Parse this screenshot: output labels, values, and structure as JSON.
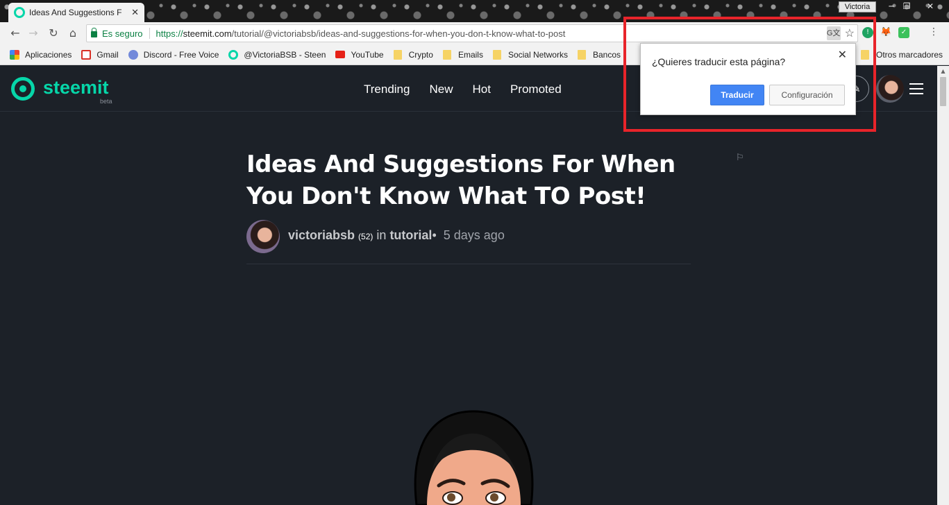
{
  "browser": {
    "tab_title": "Ideas And Suggestions For When You Don't Know What TO Post!",
    "tab_title_visible": "Ideas And Suggestions F",
    "profile_name": "Victoria",
    "secure_label": "Es seguro",
    "url_scheme": "https://",
    "url_host": "steemit.com",
    "url_path": "/tutorial/@victoriabsb/ideas-and-suggestions-for-when-you-don-t-know-what-to-post",
    "bookmarks": [
      {
        "label": "Aplicaciones",
        "icon": "apps-grid-icon",
        "color": "#4285f4"
      },
      {
        "label": "Gmail",
        "icon": "gmail-icon",
        "color": "#d93025"
      },
      {
        "label": "Discord - Free Voice",
        "icon": "discord-icon",
        "color": "#7289da"
      },
      {
        "label": "@VictoriaBSB - Steen",
        "icon": "steemit-icon",
        "color": "#06d6a9"
      },
      {
        "label": "YouTube",
        "icon": "youtube-icon",
        "color": "#e62117"
      },
      {
        "label": "Crypto",
        "icon": "folder-icon"
      },
      {
        "label": "Emails",
        "icon": "folder-icon"
      },
      {
        "label": "Social Networks",
        "icon": "folder-icon"
      },
      {
        "label": "Bancos",
        "icon": "folder-icon"
      }
    ],
    "other_bookmarks": "Otros marcadores"
  },
  "site": {
    "logo_text": "steemit",
    "logo_beta": "beta",
    "nav": [
      "Trending",
      "New",
      "Hot",
      "Promoted"
    ],
    "accent_color": "#06d6a9"
  },
  "article": {
    "title": "Ideas And Suggestions For When You Don't Know What TO Post!",
    "author": "victoriabsb",
    "reputation": "(52)",
    "in_label": "in",
    "category": "tutorial",
    "bullet": "•",
    "time": "5 days ago"
  },
  "translate_popup": {
    "question": "¿Quieres traducir esta página?",
    "translate_button": "Traducir",
    "settings_button": "Configuración",
    "highlight_color": "#e8242a"
  }
}
